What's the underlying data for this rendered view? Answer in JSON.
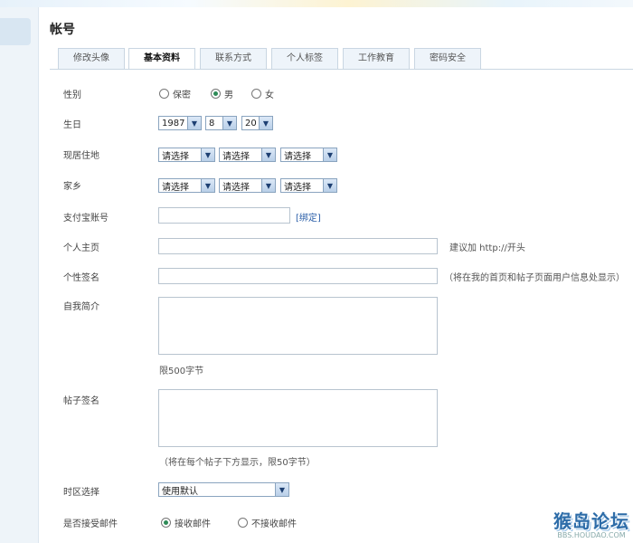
{
  "page_title": "帐号",
  "tabs": [
    {
      "label": "修改头像"
    },
    {
      "label": "基本资料"
    },
    {
      "label": "联系方式"
    },
    {
      "label": "个人标签"
    },
    {
      "label": "工作教育"
    },
    {
      "label": "密码安全"
    }
  ],
  "form": {
    "gender": {
      "label": "性别",
      "options": [
        "保密",
        "男",
        "女"
      ],
      "selected": "男"
    },
    "birthday": {
      "label": "生日",
      "year": "1987",
      "month": "8",
      "day": "20"
    },
    "residence": {
      "label": "现居住地",
      "placeholder": "请选择"
    },
    "hometown": {
      "label": "家乡",
      "placeholder": "请选择"
    },
    "alipay": {
      "label": "支付宝账号",
      "value": "",
      "bind_link": "[绑定]"
    },
    "homepage": {
      "label": "个人主页",
      "value": "",
      "hint": "建议加 http://开头"
    },
    "signature": {
      "label": "个性签名",
      "value": "",
      "hint": "（将在我的首页和帖子页面用户信息处显示）"
    },
    "bio": {
      "label": "自我简介",
      "value": "",
      "hint": "限500字节"
    },
    "post_signature": {
      "label": "帖子签名",
      "value": "",
      "hint": "（将在每个帖子下方显示，限50字节）"
    },
    "timezone": {
      "label": "时区选择",
      "value": "使用默认"
    },
    "email": {
      "label": "是否接受邮件",
      "options": [
        "接收邮件",
        "不接收邮件"
      ],
      "selected": "接收邮件"
    }
  },
  "watermark": {
    "title": "猴岛论坛",
    "url": "BBS.HOUDAO.COM"
  }
}
